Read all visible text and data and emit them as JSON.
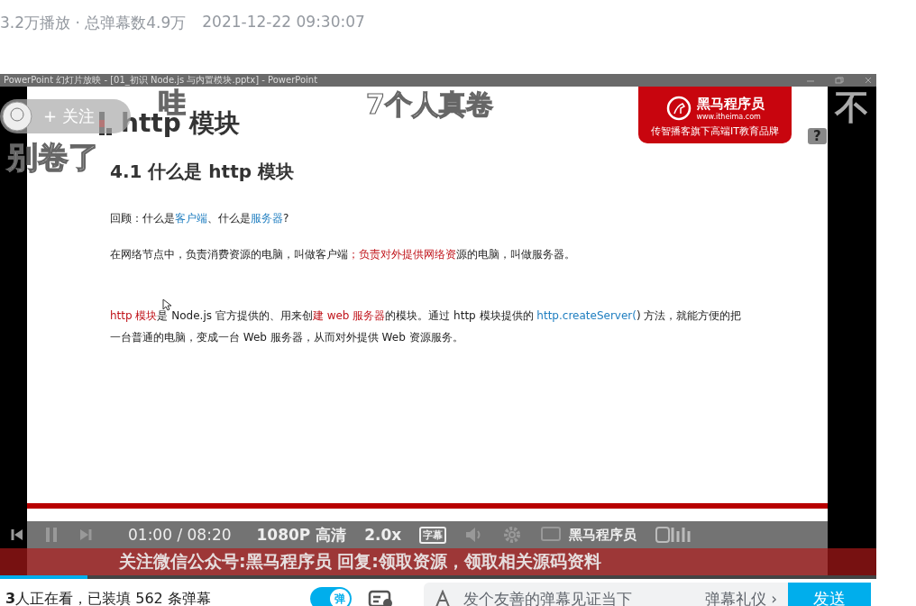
{
  "video_info": {
    "stats": "3.2万播放 · 总弹幕数4.9万",
    "date": "2021-12-22 09:30:07"
  },
  "player": {
    "window_title": "PowerPoint 幻灯片放映 - [01_初识 Node.js 与内置模块.pptx] - PowerPoint",
    "slide": {
      "heading": "http 模块",
      "logo": {
        "name": "黑马程序员",
        "url": "www.itheima.com",
        "tagline": "传智播客旗下高端IT教育品牌"
      },
      "subheading": "4.1 什么是 http 模块",
      "paragraphs": [
        {
          "text": "回顾：什么是客户端、什么是服务器?",
          "kind": "plain"
        },
        {
          "text": "在网络节点中，负责消费资源的电脑，叫做客户端；负责对外提供网络资源的电脑，叫做服务器。",
          "kind": "plain"
        },
        {
          "text": "http 模块是 Node.js 官方提供的、用来创建 web 服务器的模块。通过 http 模块提供的 http.createServer() 方法，就能方便的把一台普通的电脑，变成一台 Web 服务器，从而对外提供 Web 资源服务。",
          "kind": "spaced"
        }
      ]
    },
    "follow_button": "+ 关注",
    "danmaku": [
      {
        "text": "哇"
      },
      {
        "text": "7个人真卷"
      },
      {
        "text": "别卷了"
      },
      {
        "text": "不"
      }
    ],
    "help_badge": "?",
    "controls": {
      "time": "01:00 / 08:20",
      "quality": "1080P 高清",
      "speed": "2.0x",
      "subtitle": "字幕",
      "channel_mark": "黑马程序员",
      "playing": true
    },
    "banner": "关注微信公众号:黑马程序员  回复:领取资源，领取相关源码资料",
    "progress": {
      "level": 0.1
    }
  },
  "danmaku_bar": {
    "viewers": "**3**人正在看，已装填 562 条弹幕",
    "toggle": {
      "label": "弹",
      "on": true
    },
    "placeholder": "发个友善的弹幕见证当下",
    "etiquette": "弹幕礼仪 ›",
    "send": "发送"
  }
}
